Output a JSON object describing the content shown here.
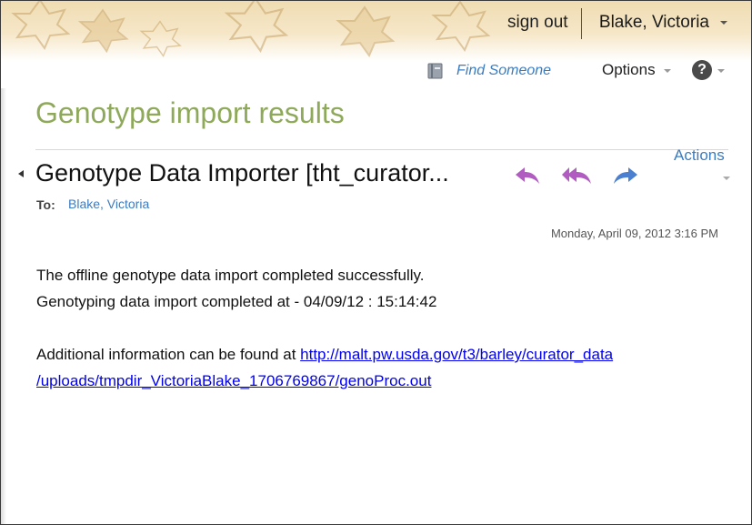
{
  "header": {
    "sign_out": "sign out",
    "user_name": "Blake, Victoria"
  },
  "toolbar": {
    "find_someone": "Find Someone",
    "options": "Options",
    "help_icon": "question-icon"
  },
  "page": {
    "title": "Genotype import results",
    "actions": "Actions"
  },
  "message": {
    "subject": "Genotype Data Importer [tht_curator...",
    "to_label": "To:",
    "to_name": "Blake, Victoria",
    "date": "Monday, April 09, 2012 3:16 PM",
    "line1": "The offline genotype data import completed successfully.",
    "line2": "Genotyping data import completed at - 04/09/12 : 15:14:42",
    "line3_prefix": "Additional information can be found at ",
    "link_part1": "http://malt.pw.usda.gov/t3/barley/curator_data",
    "link_part2": "/uploads/tmpdir_VictoriaBlake_1706769867/genoProc.out"
  },
  "colors": {
    "title_green": "#8fa95b",
    "link_blue": "#3a7cc0",
    "reply_purple": "#b05cc0",
    "forward_blue": "#4b7fd0"
  }
}
